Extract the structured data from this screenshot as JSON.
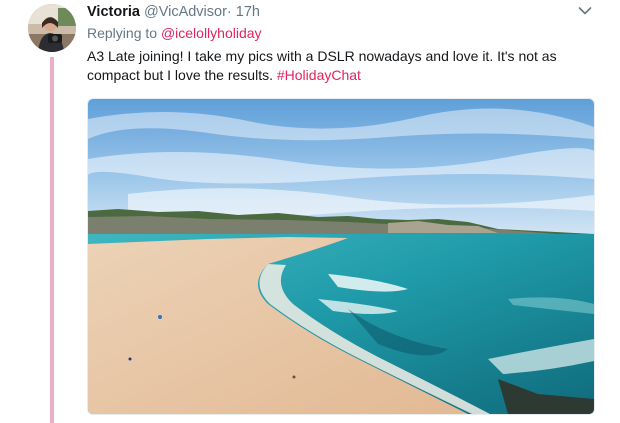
{
  "tweet": {
    "display_name": "Victoria",
    "handle": "@VicAdvisor",
    "separator": "·",
    "timestamp": "17h",
    "replying_prefix": "Replying to",
    "replying_to": "@icelollyholiday",
    "text_main": "A3 Late joining! I take my pics with a DSLR nowadays and love it. It's not as compact but I love the results. ",
    "hashtag": "#HolidayChat",
    "media_description": "beach photo",
    "menu_icon": "chevron-down-icon",
    "accent_color": "#e0245e",
    "thread_line_color": "#eab0c6"
  }
}
